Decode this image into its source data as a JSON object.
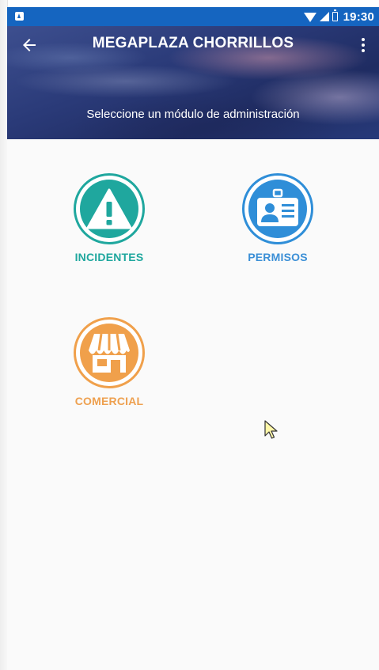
{
  "status_bar": {
    "time": "19:30",
    "icons": [
      "notification-icon",
      "wifi-icon",
      "signal-icon",
      "battery-icon"
    ]
  },
  "header": {
    "title": "MEGAPLAZA CHORRILLOS",
    "subtitle": "Seleccione un módulo de administración",
    "back_icon": "arrow-left-icon",
    "menu_icon": "more-vert-icon"
  },
  "modules": [
    {
      "label": "INCIDENTES",
      "icon": "warning-icon",
      "color": "#1fa79e"
    },
    {
      "label": "PERMISOS",
      "icon": "id-badge-icon",
      "color": "#2f8ed8"
    },
    {
      "label": "COMERCIAL",
      "icon": "store-icon",
      "color": "#f0a04b"
    }
  ],
  "colors": {
    "status_bar": "#1565c0",
    "background": "#fafafa"
  }
}
